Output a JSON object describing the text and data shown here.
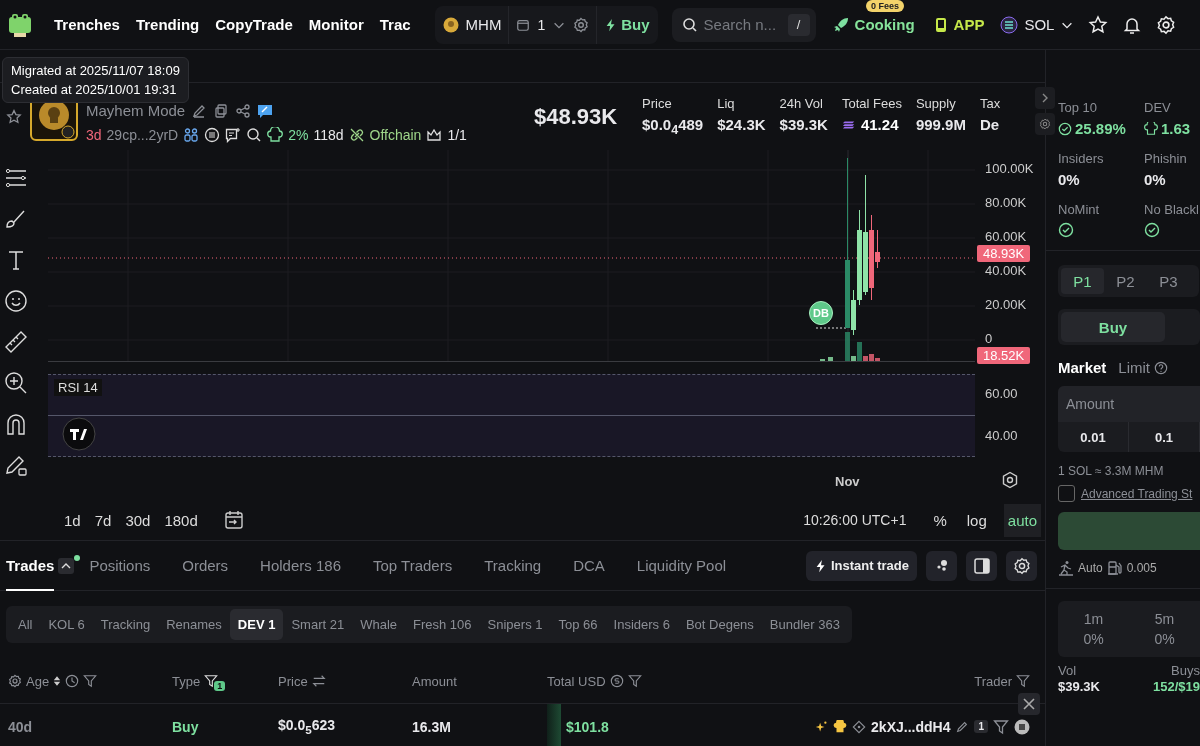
{
  "nav": {
    "links": [
      "Trenches",
      "Trending",
      "CopyTrade",
      "Monitor",
      "Trac"
    ],
    "token_chip": "MHM",
    "wallet_count": "1",
    "buy_label": "Buy",
    "search": {
      "placeholder": "Search n...",
      "shortcut": "/"
    },
    "cooking": {
      "label": "Cooking",
      "badge": "0 Fees"
    },
    "app": "APP",
    "chain": "SOL"
  },
  "tooltip": [
    "Migrated at 2025/11/07 18:09",
    "Created at 2025/10/01 19:31"
  ],
  "token": {
    "subtitle": "Mayhem Mode",
    "age": "3d",
    "address": "29cp...2yrD",
    "dev_share": "2%",
    "dev_age": "118d",
    "offchain": "Offchain",
    "crown": "1/1",
    "market_cap": "$48.93K"
  },
  "stats": [
    {
      "label": "Price",
      "value": "$0.0$_{4}$489",
      "kind": "plain"
    },
    {
      "label": "Liq",
      "value": "$24.3K",
      "kind": "plain"
    },
    {
      "label": "24h Vol",
      "value": "$39.3K",
      "kind": "plain"
    },
    {
      "label": "Total Fees",
      "value": "41.24",
      "kind": "sol"
    },
    {
      "label": "Supply",
      "value": "999.9M",
      "kind": "plain"
    },
    {
      "label": "Tax",
      "value": "De",
      "kind": "plain"
    }
  ],
  "chart": {
    "y_labels": [
      "100.00K",
      "80.00K",
      "60.00K",
      "40.00K",
      "20.00K",
      "0"
    ],
    "price_tag": "48.93K",
    "volume_tag": "18.52K",
    "marker": "DB",
    "rsi_label": "RSI 14",
    "rsi_labels": [
      "60.00",
      "40.00"
    ],
    "x_label": "Nov"
  },
  "chart_footer": {
    "ranges": [
      "1d",
      "7d",
      "30d",
      "180d"
    ],
    "time": "10:26:00 UTC+1",
    "options": [
      {
        "label": "%",
        "selected": false
      },
      {
        "label": "log",
        "selected": false
      },
      {
        "label": "auto",
        "selected": true
      }
    ]
  },
  "tabs": [
    {
      "label": "Trades",
      "selected": true
    },
    {
      "label": "Positions",
      "selected": false
    },
    {
      "label": "Orders",
      "selected": false
    },
    {
      "label": "Holders 186",
      "selected": false
    },
    {
      "label": "Top Traders",
      "selected": false
    },
    {
      "label": "Tracking",
      "selected": false
    },
    {
      "label": "DCA",
      "selected": false
    },
    {
      "label": "Liquidity Pool",
      "selected": false
    }
  ],
  "instant_trade": "Instant trade",
  "filters": [
    {
      "label": "All",
      "selected": false
    },
    {
      "label": "KOL 6",
      "selected": false
    },
    {
      "label": "Tracking",
      "selected": false
    },
    {
      "label": "Renames",
      "selected": false
    },
    {
      "label": "DEV 1",
      "selected": true
    },
    {
      "label": "Smart 21",
      "selected": false
    },
    {
      "label": "Whale",
      "selected": false
    },
    {
      "label": "Fresh 106",
      "selected": false
    },
    {
      "label": "Snipers 1",
      "selected": false
    },
    {
      "label": "Top 66",
      "selected": false
    },
    {
      "label": "Insiders 6",
      "selected": false
    },
    {
      "label": "Bot Degens",
      "selected": false
    },
    {
      "label": "Bundler 363",
      "selected": false
    }
  ],
  "table": {
    "columns": [
      "Age",
      "Type",
      "Price",
      "Amount",
      "Total USD",
      "Trader"
    ],
    "type_filter_count": "1",
    "rows": [
      {
        "age": "40d",
        "type": "Buy",
        "kind": "buy",
        "price": "$0.0$_{5}$623",
        "amount": "16.3M",
        "total": "$101.8",
        "trader": "2kXJ...ddH4",
        "trader_count": "1"
      }
    ]
  },
  "security": [
    {
      "label": "Top 10",
      "value": "25.89%",
      "kind": "check"
    },
    {
      "label": "DEV",
      "value": "1.63",
      "kind": "dev"
    },
    {
      "label": "Insiders",
      "value": "0%",
      "kind": "plain"
    },
    {
      "label": "Phishin",
      "value": "0%",
      "kind": "plain"
    }
  ],
  "flags": [
    {
      "label": "NoMint",
      "ok": true
    },
    {
      "label": "No Blackl",
      "ok": true
    }
  ],
  "presets": [
    {
      "label": "P1",
      "selected": true
    },
    {
      "label": "P2",
      "selected": false
    },
    {
      "label": "P3",
      "selected": false
    }
  ],
  "side": {
    "label": "Buy",
    "selected": true
  },
  "order_types": [
    {
      "label": "Market",
      "selected": true
    },
    {
      "label": "Limit",
      "selected": false
    }
  ],
  "amount": {
    "placeholder": "Amount",
    "quick": [
      "0.01",
      "0.1"
    ]
  },
  "rate": "1 SOL ≈ 3.3M MHM",
  "advanced": {
    "label": "Advanced Trading St",
    "checked": false
  },
  "trade_settings": {
    "slippage": "Auto",
    "fee": "0.005"
  },
  "timeframes": [
    {
      "label": "1m",
      "value": "0%"
    },
    {
      "label": "5m",
      "value": "0%"
    }
  ],
  "summary": [
    {
      "label": "Vol",
      "value": "$39.3K",
      "kind": "plain"
    },
    {
      "label": "Buys",
      "value": "152/$19",
      "kind": "buys"
    }
  ]
}
